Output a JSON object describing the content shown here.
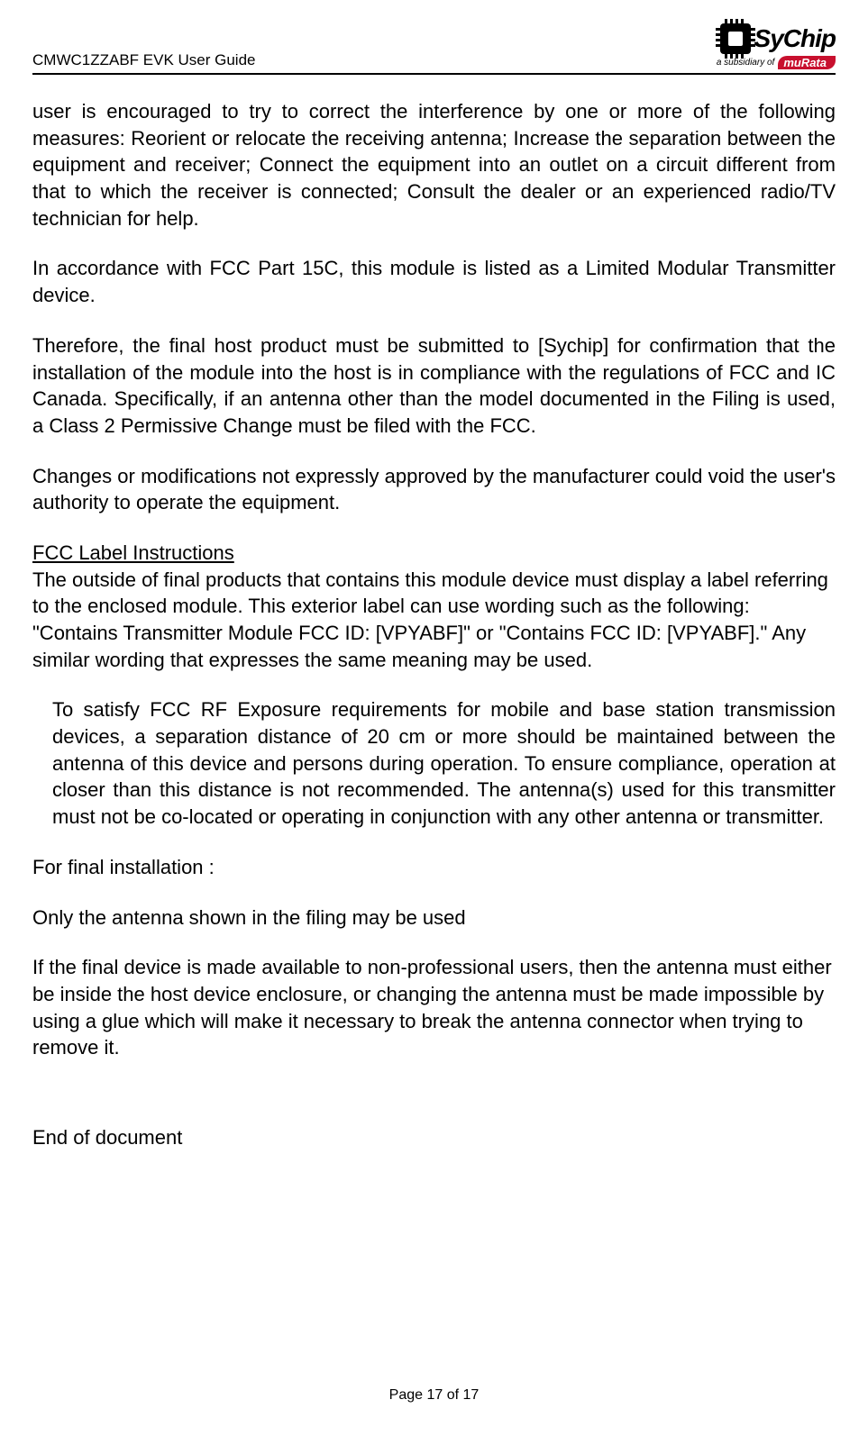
{
  "header": {
    "title": "CMWC1ZZABF EVK User Guide",
    "logo_text": "SyChip",
    "logo_sub_prefix": "a subsidiary of",
    "logo_sub_brand": "muRata"
  },
  "paragraphs": {
    "p1": "user is encouraged to try to correct the interference by one or more of the following measures: Reorient or relocate the receiving antenna; Increase the separation between the equipment and receiver; Connect the equipment into an outlet on a circuit different from that to which the receiver is connected; Consult the dealer or an experienced radio/TV technician for help.",
    "p2": "In accordance with FCC Part 15C, this module is listed as a Limited Modular Transmitter device.",
    "p3": "Therefore, the final host product must be submitted to [Sychip] for confirmation that the installation of the module into the host is in compliance with the regulations of FCC and IC Canada. Specifically, if an antenna other than the model documented in the Filing is used, a Class 2 Permissive Change must be filed with the FCC.",
    "p4": "Changes or modifications not expressly approved by the manufacturer could void the user's authority to operate the equipment.",
    "section_title": "FCC Label Instructions",
    "p5": "The outside of final products that contains this module device must display a label referring to the enclosed module. This exterior label can use wording such as the following: \"Contains Transmitter Module FCC ID: [VPYABF]\" or \"Contains FCC ID: [VPYABF].\" Any similar wording that expresses the same meaning may be used.",
    "p6": "To satisfy FCC RF Exposure requirements for mobile and base station transmission devices, a separation distance of 20 cm or more should be maintained between the antenna of this device and persons during operation. To ensure compliance, operation at closer than this distance is not recommended. The antenna(s) used for this transmitter must not be co-located or operating in conjunction with any other antenna or transmitter.",
    "p7": "For final installation :",
    "p8a": "Only the antenna shown in the filing may be used",
    "p8b": "If the final device is made available to non-professional users, then the antenna must either be inside the host device enclosure, or changing the antenna must be made impossible by using a glue which will make it necessary to break the antenna connector when trying to remove it.",
    "end": "End of document"
  },
  "footer": {
    "text": "Page  17  of  17"
  }
}
